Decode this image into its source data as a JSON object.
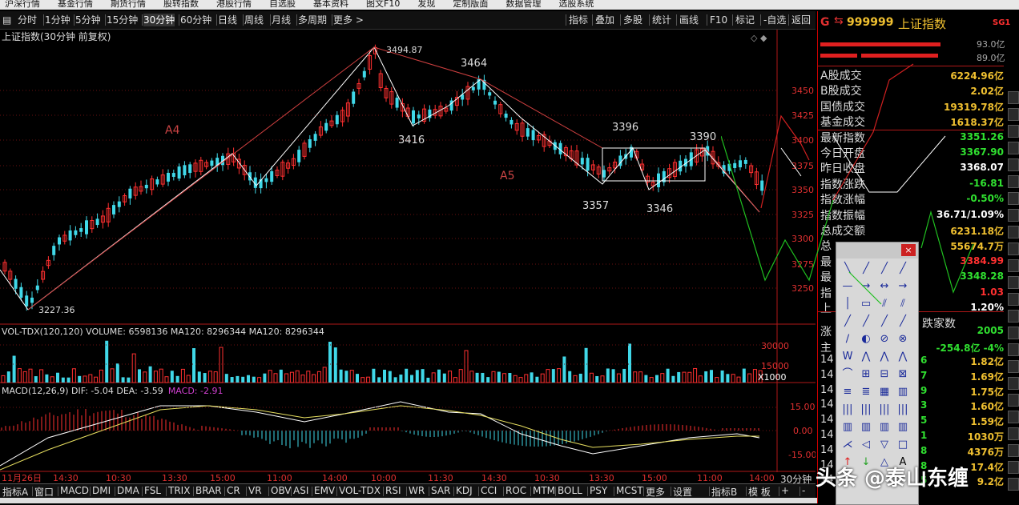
{
  "top_menu": [
    "沪深行情",
    "基金行情",
    "期货行情",
    "股转指数",
    "港股行情",
    "自选股",
    "基本资料",
    "图文F10",
    "发现",
    "定制版面",
    "数据管理",
    "选股系统"
  ],
  "period_toolbar": {
    "items": [
      "分时",
      "1分钟",
      "5分钟",
      "15分钟",
      "30分钟",
      "60分钟",
      "日线",
      "周线",
      "月线",
      "多周期",
      "更多 >"
    ],
    "selected": "30分钟",
    "right_items": [
      "指标",
      "叠加",
      "多股",
      "统计",
      "画线",
      "F10",
      "标记",
      "-自选",
      "返回"
    ]
  },
  "chart": {
    "title": "上证指数(30分钟 前复权)",
    "price_axis": [
      "3450",
      "3425",
      "3400",
      "3375",
      "3350",
      "3325",
      "3300",
      "3275",
      "3250"
    ],
    "wave_labels": [
      {
        "text": "A4",
        "color": "#cc4444"
      },
      {
        "text": "A5",
        "color": "#cc4444"
      },
      {
        "text": "3494.87",
        "color": "#dddddd"
      },
      {
        "text": "3464",
        "color": "#dddddd"
      },
      {
        "text": "3416",
        "color": "#dddddd"
      },
      {
        "text": "3396",
        "color": "#dddddd"
      },
      {
        "text": "3390",
        "color": "#dddddd"
      },
      {
        "text": "3357",
        "color": "#dddddd"
      },
      {
        "text": "3346",
        "color": "#dddddd"
      },
      {
        "text": "3227.36",
        "color": "#dddddd"
      }
    ],
    "volume_header": "VOL-TDX(120,120)  VOLUME: 6598136  MA120: 8296344  MA120: 8296344",
    "volume_axis": [
      "30000",
      "15000",
      "X1000"
    ],
    "macd_header_prefix": "MACD(12,26,9)  DIF: -5.04  DEA: -3.59",
    "macd_header_value": "MACD: -2.91",
    "macd_axis": [
      "15.00",
      "0.00",
      "-15.00"
    ],
    "time_axis": [
      "11月26日",
      "14:30",
      "10:30",
      "13:30",
      "15:00",
      "11:00",
      "14:00",
      "10:00",
      "11:30",
      "14:30",
      "10:30",
      "13:30",
      "15:00",
      "11:00",
      "14:00"
    ],
    "period_label": "30分钟"
  },
  "indicator_bar": [
    "指标A",
    "窗口",
    "MACD",
    "DMI",
    "DMA",
    "FSL",
    "TRIX",
    "BRAR",
    "CR",
    "VR",
    "OBV",
    "ASI",
    "EMV",
    "VOL-TDX",
    "RSI",
    "WR",
    "SAR",
    "KDJ",
    "CCI",
    "ROC",
    "MTM",
    "BOLL",
    "PSY",
    "MCST",
    "更多",
    "设置",
    "指标B",
    "模 板",
    "+",
    "-"
  ],
  "right_panel": {
    "header_letter": "G",
    "code": "999999",
    "name": "上证指数",
    "badge": "SG1",
    "bar_values": [
      "93.0亿",
      "89.0亿"
    ],
    "rows": [
      {
        "label": "A股成交",
        "value": "6224.96亿",
        "color": "#f0c030"
      },
      {
        "label": "B股成交",
        "value": "2.02亿",
        "color": "#f0c030"
      },
      {
        "label": "国债成交",
        "value": "19319.78亿",
        "color": "#f0c030"
      },
      {
        "label": "基金成交",
        "value": "1618.37亿",
        "color": "#f0c030"
      },
      {
        "label": "最新指数",
        "value": "3351.26",
        "color": "#30e030"
      },
      {
        "label": "今日开盘",
        "value": "3367.90",
        "color": "#30e030"
      },
      {
        "label": "昨日收盘",
        "value": "3368.07",
        "color": "#ffffff"
      },
      {
        "label": "指数涨跌",
        "value": "-16.81",
        "color": "#30e030"
      },
      {
        "label": "指数涨幅",
        "value": "-0.50%",
        "color": "#30e030"
      },
      {
        "label": "指数振幅",
        "value": "36.71/1.09%",
        "color": "#ffffff"
      },
      {
        "label": "总成交额",
        "value": "6231.18亿",
        "color": "#f0c030"
      },
      {
        "label": "总",
        "value": "55674.7万",
        "color": "#f0c030"
      },
      {
        "label": "最",
        "value": "3384.99",
        "color": "#ff3030"
      },
      {
        "label": "最",
        "value": "3348.28",
        "color": "#30e030"
      },
      {
        "label": "指",
        "value": "1.03",
        "color": "#ff3030"
      },
      {
        "label": "上",
        "value": "1.20%",
        "color": "#ffffff"
      },
      {
        "label": "涨",
        "value": "2005",
        "color": "#30e030"
      },
      {
        "label": "主",
        "value": "-254.8亿   -4%",
        "color": "#30e030"
      }
    ],
    "mid_text": "跌家数",
    "flow_rows": [
      {
        "t": "14",
        "n": "6",
        "v": "1.82亿"
      },
      {
        "t": "14",
        "n": "7",
        "v": "1.69亿"
      },
      {
        "t": "14",
        "n": "9",
        "v": "1.75亿"
      },
      {
        "t": "14",
        "n": "3",
        "v": "1.60亿"
      },
      {
        "t": "14",
        "n": "5",
        "v": "1.59亿"
      },
      {
        "t": "14",
        "n": "1",
        "v": "1030万"
      },
      {
        "t": "14",
        "n": "8",
        "v": "4376万"
      },
      {
        "t": "14",
        "n": "8",
        "v": "17.4亿"
      },
      {
        "t": "14",
        "n": "5",
        "v": "9.2亿"
      }
    ]
  },
  "toolbox": {
    "close_label": "×"
  },
  "watermark": "头条 @泰山东缠"
}
